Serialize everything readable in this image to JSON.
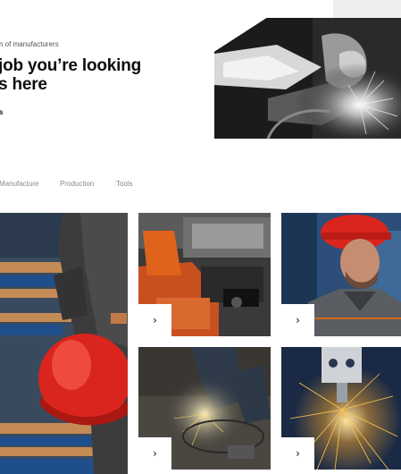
{
  "hero": {
    "eyebrow": "n of manufacturers",
    "headline_line1": "job you’re looking",
    "headline_line2": "s here",
    "link_fragment": "s"
  },
  "filters": [
    {
      "label": "Manufacture"
    },
    {
      "label": "Production"
    },
    {
      "label": "Tools"
    }
  ],
  "cards": [
    {
      "name": "red-helmet-worker",
      "arrow": "›"
    },
    {
      "name": "machine-parts",
      "arrow": "›"
    },
    {
      "name": "worker-portrait",
      "arrow": "›"
    },
    {
      "name": "welding-floor",
      "arrow": "›"
    },
    {
      "name": "laser-cutter",
      "arrow": "›"
    }
  ],
  "colors": {
    "accent_red": "#d9251d",
    "machine_orange": "#e0631c",
    "steel_blue": "#2c4e78",
    "spark_yellow": "#ffd26a",
    "corner_gray": "#eeeeee"
  }
}
